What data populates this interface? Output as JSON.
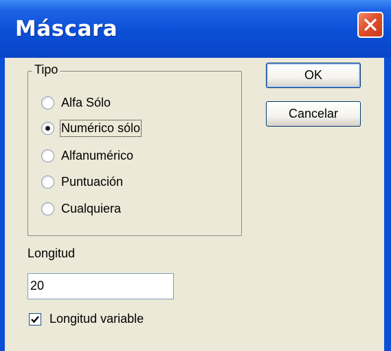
{
  "window": {
    "title": "Máscara"
  },
  "group": {
    "label": "Tipo",
    "options": [
      {
        "label": "Alfa Sólo",
        "checked": false
      },
      {
        "label": "Numérico sólo",
        "checked": true
      },
      {
        "label": "Alfanumérico",
        "checked": false
      },
      {
        "label": "Puntuación",
        "checked": false
      },
      {
        "label": "Cualquiera",
        "checked": false
      }
    ]
  },
  "buttons": {
    "ok": "OK",
    "cancel": "Cancelar"
  },
  "length": {
    "label": "Longitud",
    "value": "20"
  },
  "variable_length": {
    "label": "Longitud variable",
    "checked": true
  },
  "colors": {
    "titlebar": "#0A4FD6",
    "client": "#ECE9D8",
    "close": "#E0502E"
  },
  "icons": {
    "close": "close-icon",
    "check": "checkmark-icon"
  }
}
